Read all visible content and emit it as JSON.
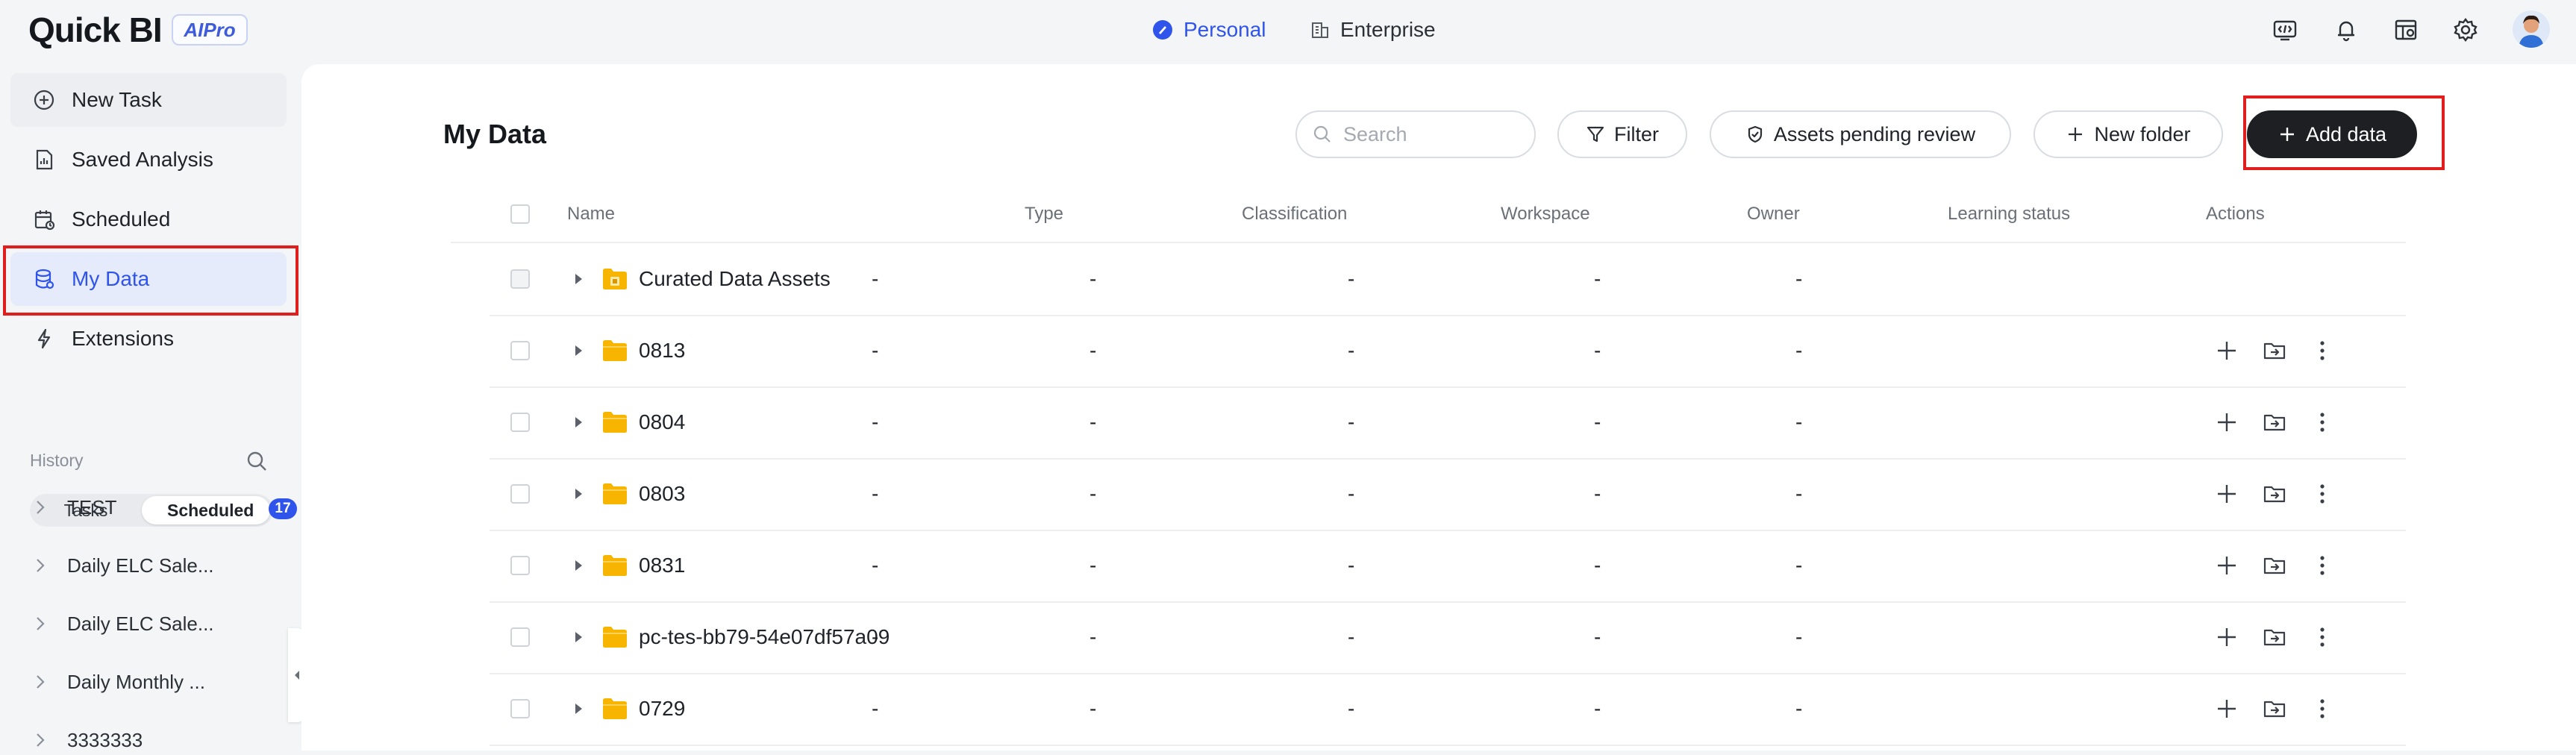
{
  "app": {
    "logo": "Quick BI",
    "logo_badge": "AIPro",
    "modes": [
      {
        "label": "Personal",
        "active": true
      },
      {
        "label": "Enterprise",
        "active": false
      }
    ],
    "top_icons": [
      "code-icon",
      "bell-icon",
      "dashboard-config-icon",
      "gear-icon",
      "user-avatar"
    ]
  },
  "sidebar": {
    "items": [
      {
        "label": "New Task",
        "icon": "plus-circle-icon"
      },
      {
        "label": "Saved Analysis",
        "icon": "report-icon"
      },
      {
        "label": "Scheduled",
        "icon": "calendar-icon"
      },
      {
        "label": "My Data",
        "icon": "database-icon",
        "active": true
      },
      {
        "label": "Extensions",
        "icon": "lightning-icon"
      }
    ],
    "history": {
      "label": "History",
      "tabs": {
        "tasks": "Tasks",
        "scheduled": "Scheduled",
        "scheduled_count": "17"
      },
      "items": [
        "TEST",
        "Daily ELC Sale...",
        "Daily ELC Sale...",
        "Daily Monthly ...",
        "3333333"
      ]
    }
  },
  "main": {
    "title": "My Data",
    "search_placeholder": "Search",
    "buttons": {
      "filter": "Filter",
      "pending": "Assets pending review",
      "new_folder": "New folder",
      "add_data": "Add data"
    },
    "columns": [
      "Name",
      "Type",
      "Classification",
      "Workspace",
      "Owner",
      "Learning status",
      "Actions"
    ],
    "rows": [
      {
        "name": "Curated Data Assets",
        "type": "-",
        "classification": "-",
        "workspace": "-",
        "owner": "-",
        "learning": "-",
        "special": true
      },
      {
        "name": "0813",
        "type": "-",
        "classification": "-",
        "workspace": "-",
        "owner": "-",
        "learning": "-"
      },
      {
        "name": "0804",
        "type": "-",
        "classification": "-",
        "workspace": "-",
        "owner": "-",
        "learning": "-"
      },
      {
        "name": "0803",
        "type": "-",
        "classification": "-",
        "workspace": "-",
        "owner": "-",
        "learning": "-"
      },
      {
        "name": "0831",
        "type": "-",
        "classification": "-",
        "workspace": "-",
        "owner": "-",
        "learning": "-"
      },
      {
        "name": "pc-tes-bb79-54e07df57a09",
        "type": "-",
        "classification": "-",
        "workspace": "-",
        "owner": "-",
        "learning": "-"
      },
      {
        "name": "0729",
        "type": "-",
        "classification": "-",
        "workspace": "-",
        "owner": "-",
        "learning": "-"
      }
    ]
  },
  "colors": {
    "accent": "#2f54eb",
    "folder": "#f7b500",
    "highlight_box": "#e11e1e",
    "primary_button": "#1d1f23"
  }
}
